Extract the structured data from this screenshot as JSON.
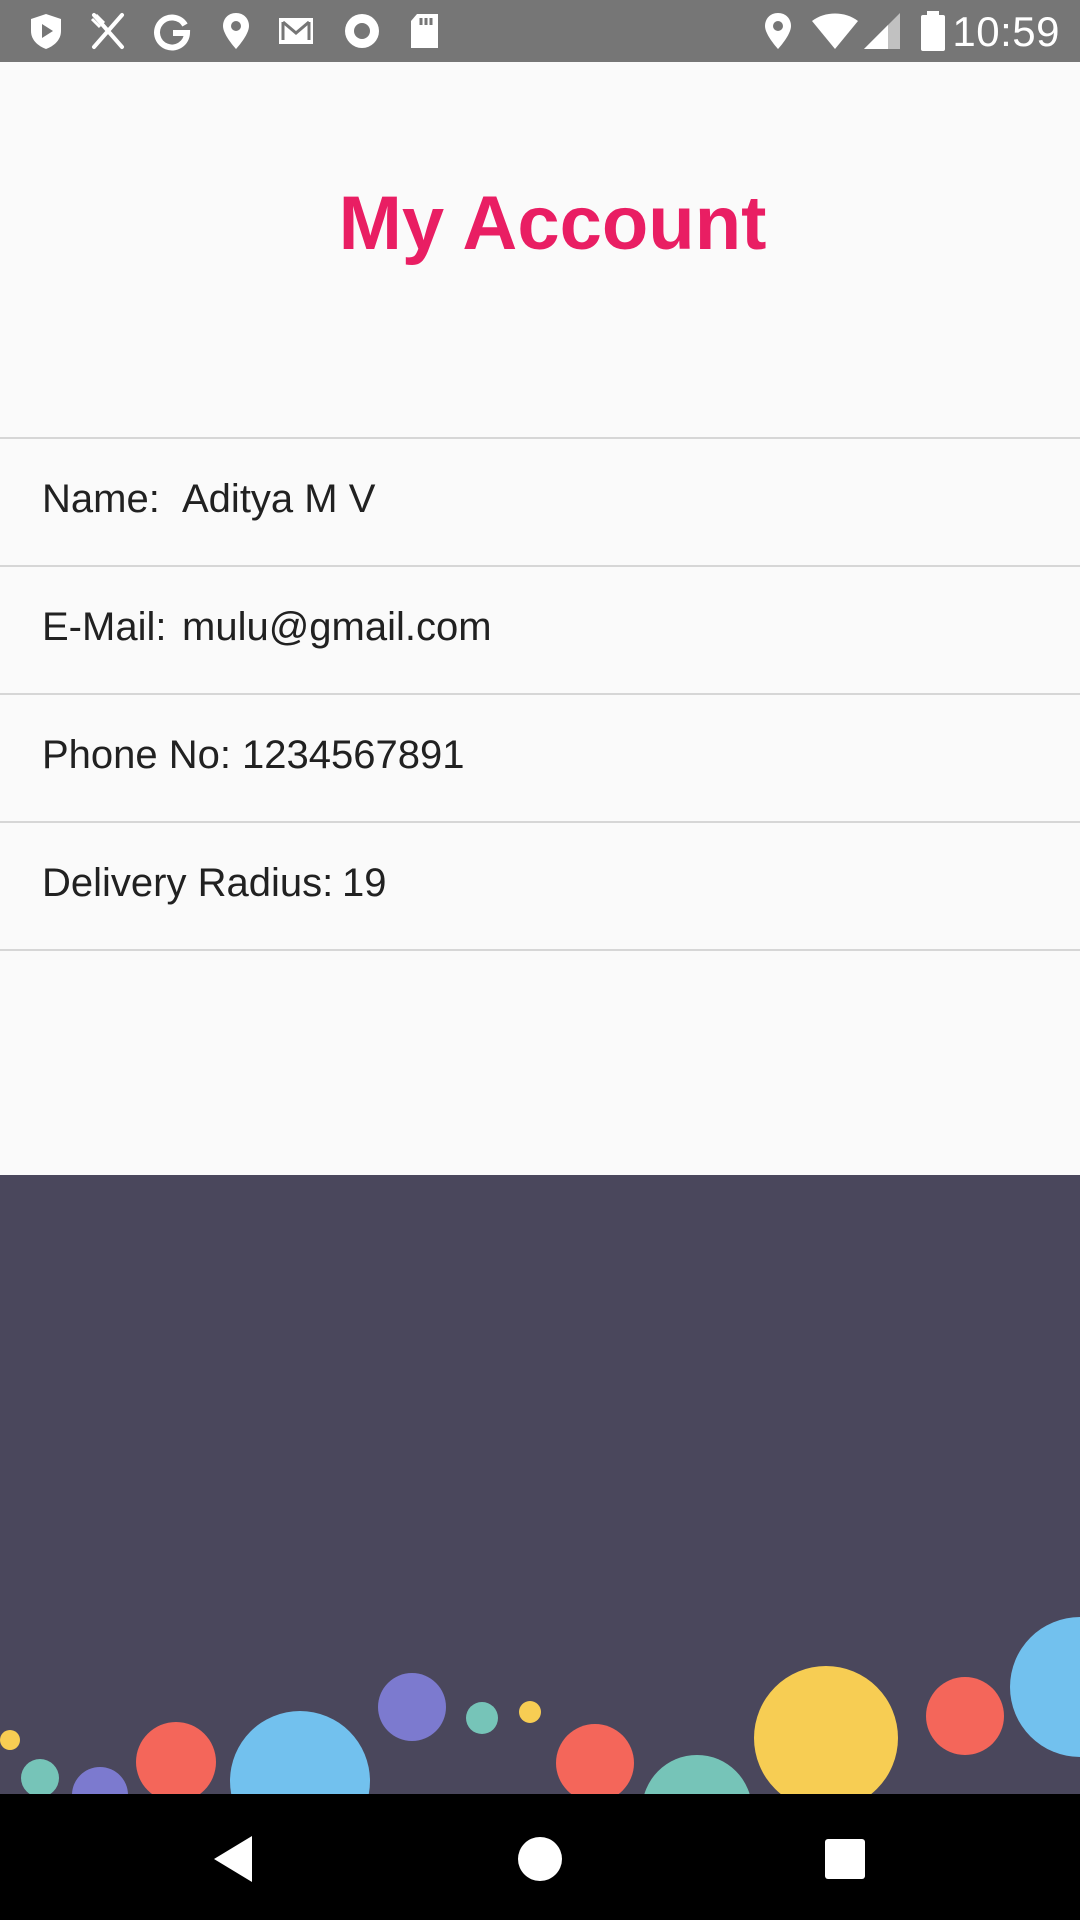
{
  "status_bar": {
    "time": "10:59",
    "left_icons": [
      "shield-play-icon",
      "utensils-icon",
      "google-icon",
      "location-pin-icon",
      "gmail-icon",
      "record-icon",
      "sd-card-icon"
    ],
    "right_icons": [
      "location-pin-icon",
      "wifi-icon",
      "signal-icon",
      "battery-icon"
    ]
  },
  "header": {
    "title": "My Account",
    "title_color": "#e91e63"
  },
  "account": {
    "name_label": "Name:",
    "name_value": "Aditya M V",
    "email_label": "E-Mail:",
    "email_value": "mulu@gmail.com",
    "phone_label": "Phone No:",
    "phone_value": "1234567891",
    "radius_label": "Delivery Radius:",
    "radius_value": "19"
  },
  "footer": {
    "background": "#4a475c",
    "bubble_colors": [
      "#f4665a",
      "#72c1ee",
      "#7c7acf",
      "#76c4b8",
      "#f7cd53"
    ]
  },
  "nav_bar": {
    "icons": [
      "back-icon",
      "home-icon",
      "recents-icon"
    ]
  }
}
